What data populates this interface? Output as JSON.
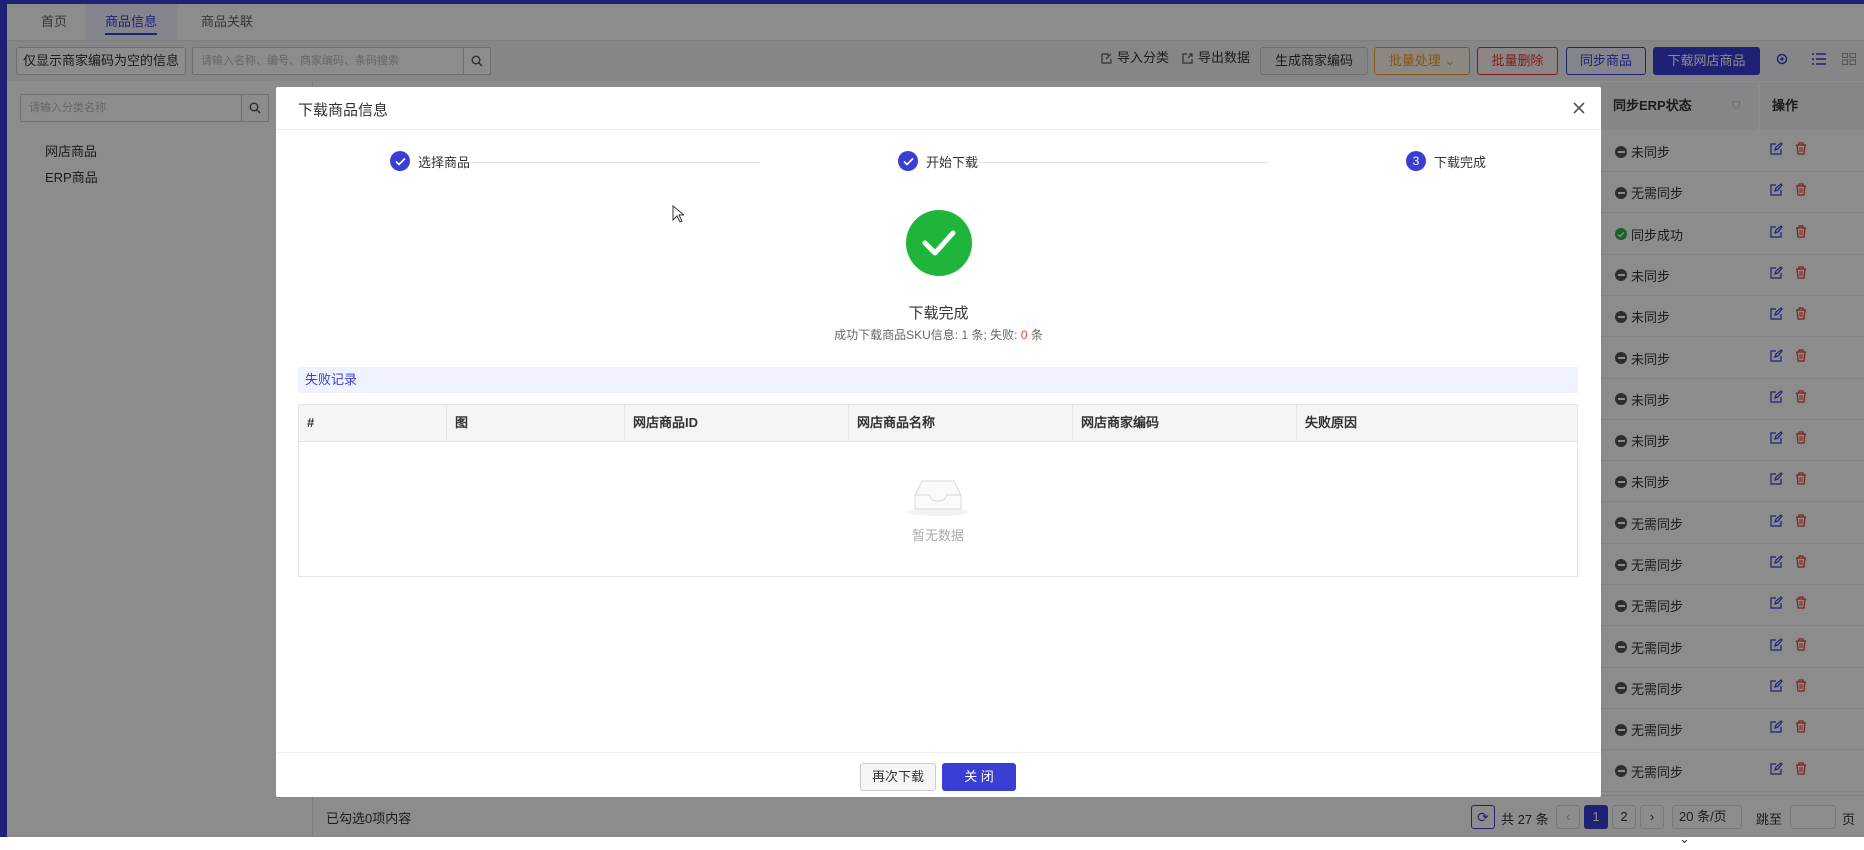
{
  "tabs": [
    "首页",
    "商品信息",
    "商品关联"
  ],
  "toolbar": {
    "filter_btn": "仅显示商家编码为空的信息",
    "search_placeholder": "请输入名称、编号、商家编码、条码搜索",
    "import_cat": "导入分类",
    "export_data": "导出数据",
    "gen_code": "生成商家编码",
    "batch_process": "批量处理",
    "batch_delete": "批量删除",
    "sync_goods": "同步商品",
    "download_goods": "下载网店商品"
  },
  "colors": {
    "accent": "#3a3fd4",
    "success": "#1fb53b",
    "warning": "#f0a020",
    "danger": "#e53935"
  },
  "sidebar": {
    "search_placeholder": "请输入分类名称",
    "items": [
      "网店商品",
      "ERP商品"
    ]
  },
  "table": {
    "col_status": "同步ERP状态",
    "col_ops": "操作",
    "rows": [
      "未同步",
      "无需同步",
      "同步成功",
      "未同步",
      "未同步",
      "未同步",
      "未同步",
      "未同步",
      "未同步",
      "无需同步",
      "无需同步",
      "无需同步",
      "无需同步",
      "无需同步",
      "无需同步",
      "无需同步"
    ]
  },
  "bottom": {
    "selected": "已勾选0项内容",
    "total": "共 27 条",
    "page1": "1",
    "page2": "2",
    "per_page": "20 条/页",
    "goto": "跳至",
    "page_unit": "页"
  },
  "modal": {
    "title": "下载商品信息",
    "steps": [
      {
        "label": "选择商品",
        "num": ""
      },
      {
        "label": "开始下载",
        "num": ""
      },
      {
        "label": "下载完成",
        "num": "3"
      }
    ],
    "done_title": "下载完成",
    "done_prefix": "成功下载商品SKU信息: ",
    "done_success": "1",
    "done_mid": " 条; 失败: ",
    "done_fail": "0",
    "done_suffix": " 条",
    "section": "失败记录",
    "fail_columns": [
      "#",
      "图",
      "网店商品ID",
      "网店商品名称",
      "网店商家编码",
      "失败原因"
    ],
    "empty": "暂无数据",
    "redownload": "再次下载",
    "close": "关 闭"
  }
}
